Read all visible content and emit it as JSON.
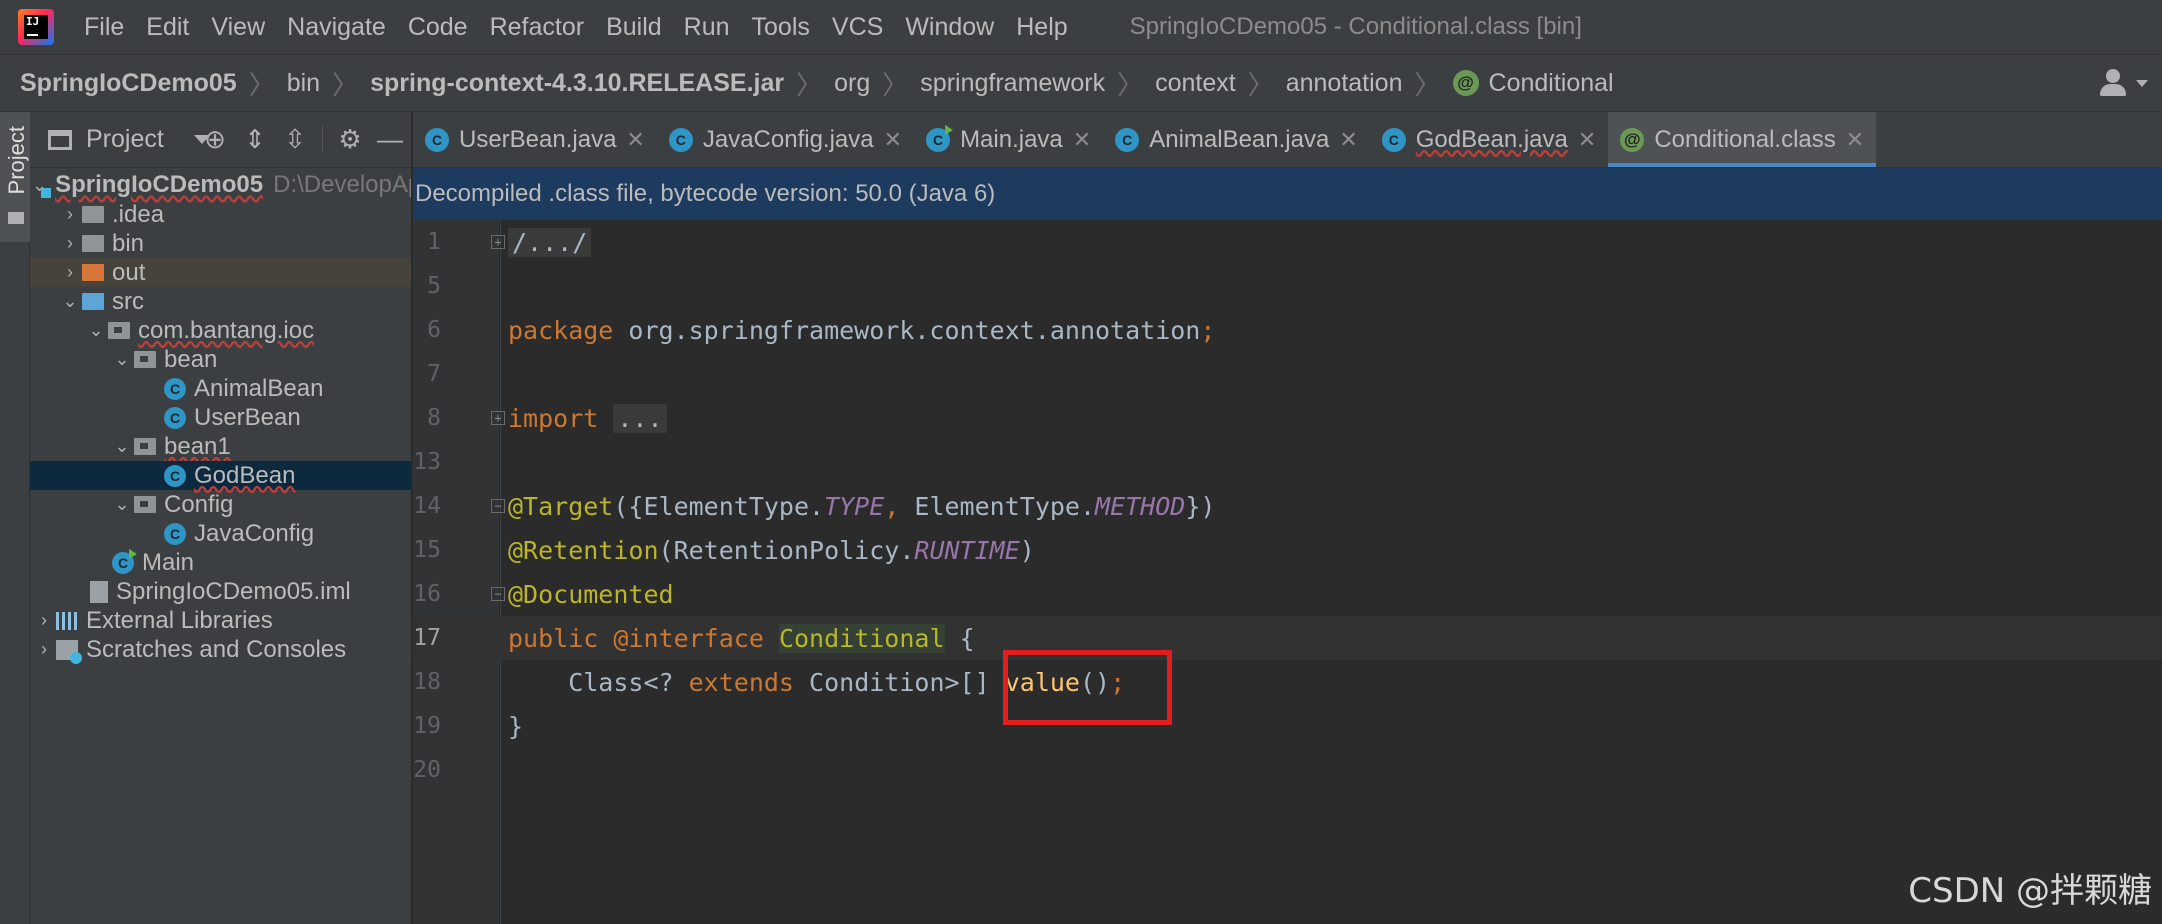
{
  "menubar": {
    "items": [
      "File",
      "Edit",
      "View",
      "Navigate",
      "Code",
      "Refactor",
      "Build",
      "Run",
      "Tools",
      "VCS",
      "Window",
      "Help"
    ],
    "window_title": "SpringIoCDemo05 - Conditional.class [bin]"
  },
  "breadcrumb": {
    "items": [
      "SpringIoCDemo05",
      "bin",
      "spring-context-4.3.10.RELEASE.jar",
      "org",
      "springframework",
      "context",
      "annotation",
      "Conditional"
    ]
  },
  "tool_stripe": {
    "label": "Project"
  },
  "project_panel": {
    "title": "Project",
    "tree": [
      {
        "label": "SpringIoCDemo05",
        "suffix": "D:\\DevelopApplica"
      },
      {
        "label": ".idea"
      },
      {
        "label": "bin"
      },
      {
        "label": "out"
      },
      {
        "label": "src"
      },
      {
        "label": "com.bantang.ioc"
      },
      {
        "label": "bean"
      },
      {
        "label": "AnimalBean"
      },
      {
        "label": "UserBean"
      },
      {
        "label": "bean1"
      },
      {
        "label": "GodBean"
      },
      {
        "label": "Config"
      },
      {
        "label": "JavaConfig"
      },
      {
        "label": "Main"
      },
      {
        "label": "SpringIoCDemo05.iml"
      },
      {
        "label": "External Libraries"
      },
      {
        "label": "Scratches and Consoles"
      }
    ]
  },
  "tabs": [
    {
      "label": "UserBean.java"
    },
    {
      "label": "JavaConfig.java"
    },
    {
      "label": "Main.java"
    },
    {
      "label": "AnimalBean.java"
    },
    {
      "label": "GodBean.java"
    },
    {
      "label": "Conditional.class",
      "active": true
    }
  ],
  "banner": {
    "text": "Decompiled .class file, bytecode version: 50.0 (Java 6)"
  },
  "editor": {
    "line_numbers": [
      "1",
      "5",
      "6",
      "7",
      "8",
      "13",
      "14",
      "15",
      "16",
      "17",
      "18",
      "19",
      "20"
    ],
    "current_line": "17",
    "tokens": {
      "l1_fold": "/.../",
      "l6_kw": "package",
      "l6_pkg": " org.springframework.context.annotation",
      "l6_semi": ";",
      "l8_kw": "import",
      "l8_fold": "...",
      "l14_ann": "@Target",
      "l14_a": "({ElementType.",
      "l14_c1": "TYPE",
      "l14_comma": ", ",
      "l14_b": "ElementType.",
      "l14_c2": "METHOD",
      "l14_end": "})",
      "l15_ann": "@Retention",
      "l15_a": "(RetentionPolicy.",
      "l15_c": "RUNTIME",
      "l15_end": ")",
      "l16_ann": "@Documented",
      "l17_kw1": "public",
      "l17_kw2": "@interface",
      "l17_name": "Conditional",
      "l17_brace": " {",
      "l18_a": "    Class<? ",
      "l18_kw": "extends",
      "l18_type": " Condition",
      "l18_b": ">[] ",
      "l18_fn": "value",
      "l18_c": "()",
      "l18_semi": ";",
      "l19_brace": "}"
    }
  },
  "watermark": "CSDN @拌颗糖",
  "colors": {
    "annotation_box": "#e11d1d",
    "active_tab_underline": "#4a88c7"
  }
}
